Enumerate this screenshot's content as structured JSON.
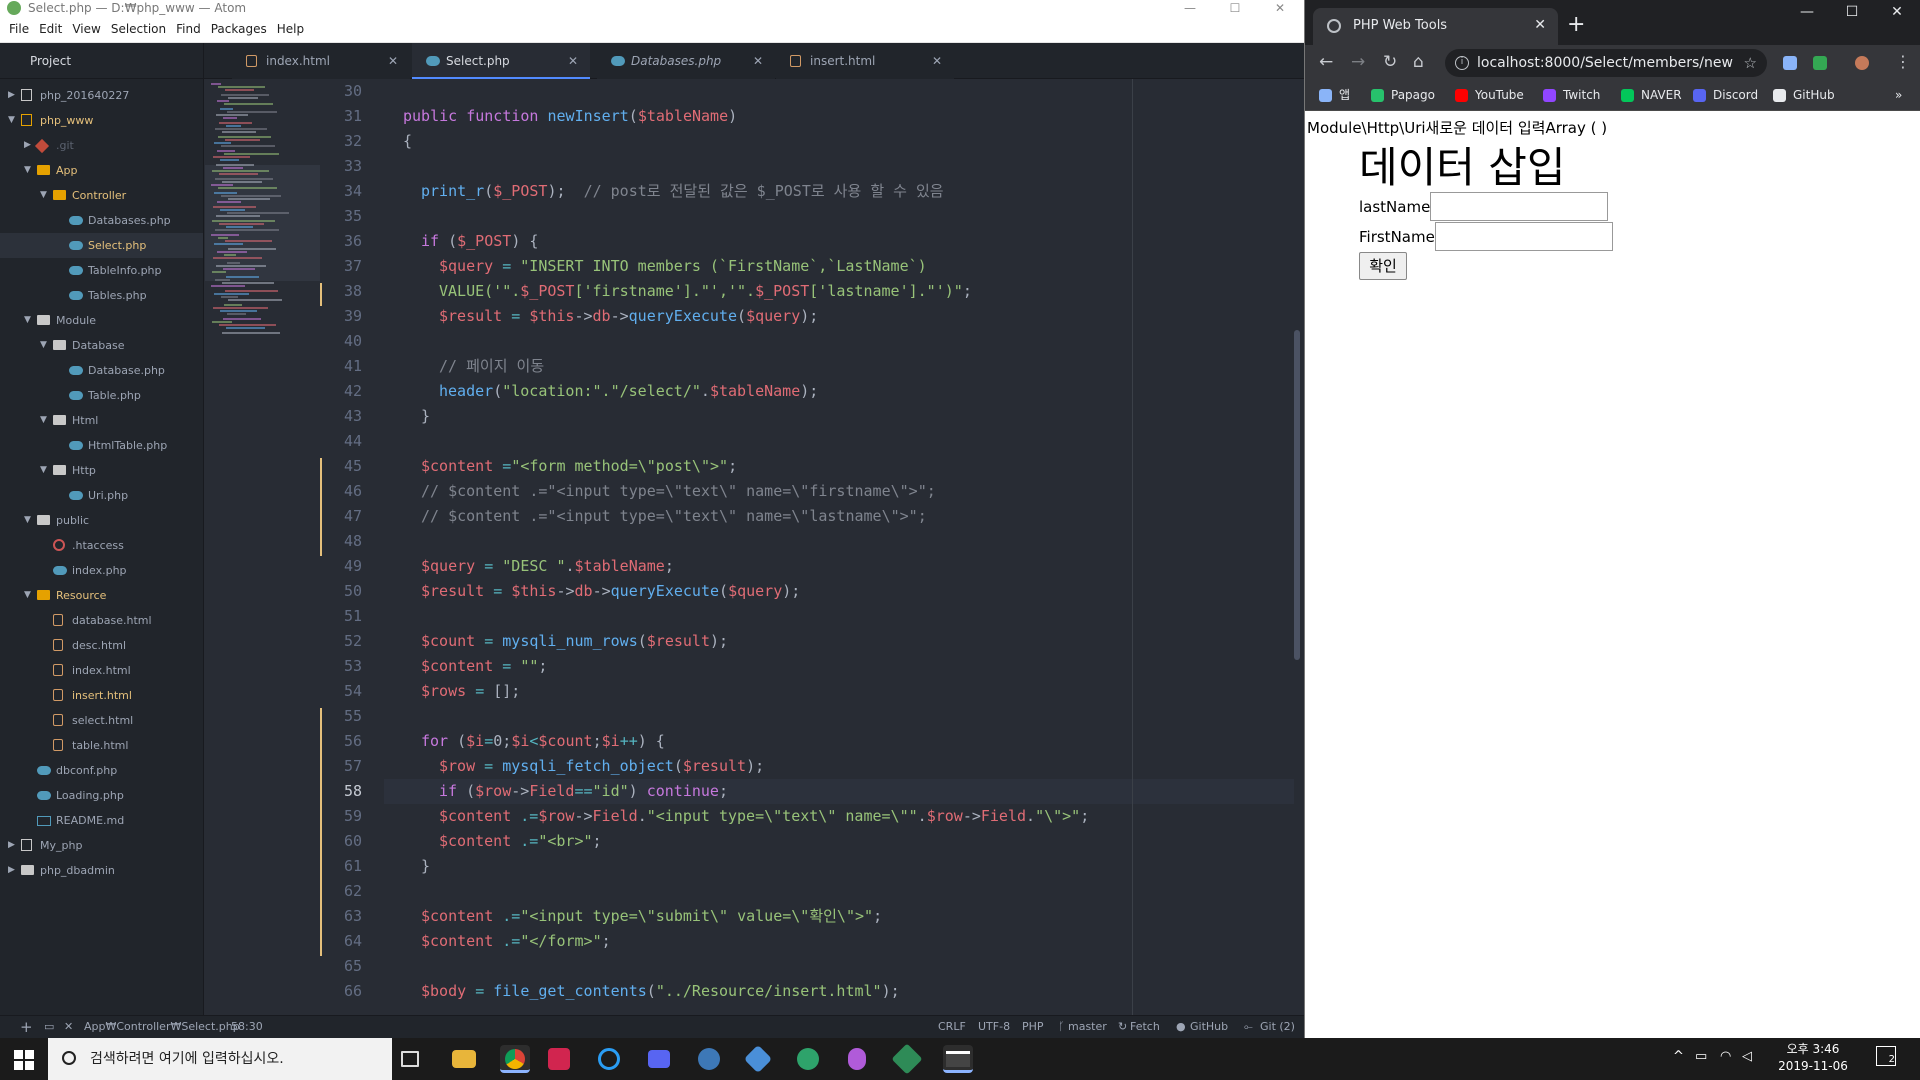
{
  "atom": {
    "title": "Select.php — D:₩php_www — Atom",
    "menu": [
      "File",
      "Edit",
      "View",
      "Selection",
      "Find",
      "Packages",
      "Help"
    ],
    "tree_header": "Project",
    "tabs": [
      {
        "label": "index.html",
        "type": "html",
        "active": false,
        "italic": false
      },
      {
        "label": "Select.php",
        "type": "php",
        "active": true,
        "italic": false
      },
      {
        "label": "Databases.php",
        "type": "php",
        "active": false,
        "italic": true
      },
      {
        "label": "insert.html",
        "type": "html",
        "active": false,
        "italic": false
      }
    ],
    "tree": [
      {
        "label": "php_201640227",
        "depth": 0,
        "icon": "repo",
        "arrow": "right",
        "mod": false,
        "sel": false
      },
      {
        "label": "php_www",
        "depth": 0,
        "icon": "repo",
        "arrow": "down",
        "mod": true,
        "sel": false
      },
      {
        "label": ".git",
        "depth": 1,
        "icon": "git",
        "arrow": "right",
        "mod": false,
        "sel": false,
        "dim": true
      },
      {
        "label": "App",
        "depth": 1,
        "icon": "folder",
        "arrow": "down",
        "mod": true,
        "sel": false
      },
      {
        "label": "Controller",
        "depth": 2,
        "icon": "folder",
        "arrow": "down",
        "mod": true,
        "sel": false
      },
      {
        "label": "Databases.php",
        "depth": 3,
        "icon": "php",
        "arrow": "",
        "mod": false,
        "sel": false
      },
      {
        "label": "Select.php",
        "depth": 3,
        "icon": "php",
        "arrow": "",
        "mod": true,
        "sel": true
      },
      {
        "label": "TableInfo.php",
        "depth": 3,
        "icon": "php",
        "arrow": "",
        "mod": false,
        "sel": false
      },
      {
        "label": "Tables.php",
        "depth": 3,
        "icon": "php",
        "arrow": "",
        "mod": false,
        "sel": false
      },
      {
        "label": "Module",
        "depth": 1,
        "icon": "folder",
        "arrow": "down",
        "mod": false,
        "sel": false
      },
      {
        "label": "Database",
        "depth": 2,
        "icon": "folder",
        "arrow": "down",
        "mod": false,
        "sel": false
      },
      {
        "label": "Database.php",
        "depth": 3,
        "icon": "php",
        "arrow": "",
        "mod": false,
        "sel": false
      },
      {
        "label": "Table.php",
        "depth": 3,
        "icon": "php",
        "arrow": "",
        "mod": false,
        "sel": false
      },
      {
        "label": "Html",
        "depth": 2,
        "icon": "folder",
        "arrow": "down",
        "mod": false,
        "sel": false
      },
      {
        "label": "HtmlTable.php",
        "depth": 3,
        "icon": "php",
        "arrow": "",
        "mod": false,
        "sel": false
      },
      {
        "label": "Http",
        "depth": 2,
        "icon": "folder",
        "arrow": "down",
        "mod": false,
        "sel": false
      },
      {
        "label": "Uri.php",
        "depth": 3,
        "icon": "php",
        "arrow": "",
        "mod": false,
        "sel": false
      },
      {
        "label": "public",
        "depth": 1,
        "icon": "folder",
        "arrow": "down",
        "mod": false,
        "sel": false
      },
      {
        "label": ".htaccess",
        "depth": 2,
        "icon": "gear",
        "arrow": "",
        "mod": false,
        "sel": false
      },
      {
        "label": "index.php",
        "depth": 2,
        "icon": "php",
        "arrow": "",
        "mod": false,
        "sel": false
      },
      {
        "label": "Resource",
        "depth": 1,
        "icon": "folder",
        "arrow": "down",
        "mod": true,
        "sel": false
      },
      {
        "label": "database.html",
        "depth": 2,
        "icon": "html",
        "arrow": "",
        "mod": false,
        "sel": false
      },
      {
        "label": "desc.html",
        "depth": 2,
        "icon": "html",
        "arrow": "",
        "mod": false,
        "sel": false
      },
      {
        "label": "index.html",
        "depth": 2,
        "icon": "html",
        "arrow": "",
        "mod": false,
        "sel": false
      },
      {
        "label": "insert.html",
        "depth": 2,
        "icon": "html",
        "arrow": "",
        "mod": true,
        "sel": false
      },
      {
        "label": "select.html",
        "depth": 2,
        "icon": "html",
        "arrow": "",
        "mod": false,
        "sel": false
      },
      {
        "label": "table.html",
        "depth": 2,
        "icon": "html",
        "arrow": "",
        "mod": false,
        "sel": false
      },
      {
        "label": "dbconf.php",
        "depth": 1,
        "icon": "php",
        "arrow": "",
        "mod": false,
        "sel": false
      },
      {
        "label": "Loading.php",
        "depth": 1,
        "icon": "php",
        "arrow": "",
        "mod": false,
        "sel": false
      },
      {
        "label": "README.md",
        "depth": 1,
        "icon": "md",
        "arrow": "",
        "mod": false,
        "sel": false
      },
      {
        "label": "My_php",
        "depth": 0,
        "icon": "repo",
        "arrow": "right",
        "mod": false,
        "sel": false
      },
      {
        "label": "php_dbadmin",
        "depth": 0,
        "icon": "folder",
        "arrow": "right",
        "mod": false,
        "sel": false
      }
    ],
    "cursor_line": 58,
    "code": [
      {
        "n": 30,
        "i": 0,
        "t": []
      },
      {
        "n": 31,
        "i": 0,
        "t": [
          [
            "k",
            "public "
          ],
          [
            "k",
            "function "
          ],
          [
            "f",
            "newInsert"
          ],
          [
            "t",
            "("
          ],
          [
            "v",
            "$tableName"
          ],
          [
            "t",
            ")"
          ]
        ]
      },
      {
        "n": 32,
        "i": 0,
        "t": [
          [
            "t",
            "{"
          ]
        ]
      },
      {
        "n": 33,
        "i": 0,
        "t": []
      },
      {
        "n": 34,
        "i": 1,
        "t": [
          [
            "f",
            "print_r"
          ],
          [
            "t",
            "("
          ],
          [
            "v",
            "$_POST"
          ],
          [
            "t",
            ");  "
          ],
          [
            "c",
            "// post로 전달된 값은 $_POST로 사용 할 수 있음"
          ]
        ]
      },
      {
        "n": 35,
        "i": 0,
        "t": []
      },
      {
        "n": 36,
        "i": 1,
        "t": [
          [
            "k",
            "if "
          ],
          [
            "t",
            "("
          ],
          [
            "v",
            "$_POST"
          ],
          [
            "t",
            ") {"
          ]
        ]
      },
      {
        "n": 37,
        "i": 2,
        "t": [
          [
            "v",
            "$query "
          ],
          [
            "o",
            "= "
          ],
          [
            "s",
            "\"INSERT INTO members (`FirstName`,`LastName`)"
          ]
        ]
      },
      {
        "n": 38,
        "i": 2,
        "t": [
          [
            "s",
            "VALUE('\"."
          ],
          [
            "v",
            "$_POST"
          ],
          [
            "s",
            "['firstname']"
          ],
          [
            "s",
            ".\"','\"."
          ],
          [
            "v",
            "$_POST"
          ],
          [
            "s",
            "['lastname']"
          ],
          [
            "s",
            ".\"')\""
          ],
          [
            "t",
            ";"
          ]
        ]
      },
      {
        "n": 39,
        "i": 2,
        "t": [
          [
            "v",
            "$result "
          ],
          [
            "o",
            "= "
          ],
          [
            "v",
            "$this"
          ],
          [
            "t",
            "->"
          ],
          [
            "v",
            "db"
          ],
          [
            "t",
            "->"
          ],
          [
            "f",
            "queryExecute"
          ],
          [
            "t",
            "("
          ],
          [
            "v",
            "$query"
          ],
          [
            "t",
            ");"
          ]
        ]
      },
      {
        "n": 40,
        "i": 0,
        "t": []
      },
      {
        "n": 41,
        "i": 2,
        "t": [
          [
            "c",
            "// 페이지 이동"
          ]
        ]
      },
      {
        "n": 42,
        "i": 2,
        "t": [
          [
            "f",
            "header"
          ],
          [
            "t",
            "("
          ],
          [
            "s",
            "\"location:\".\"/select/\""
          ],
          [
            "t",
            "."
          ],
          [
            "v",
            "$tableName"
          ],
          [
            "t",
            ");"
          ]
        ]
      },
      {
        "n": 43,
        "i": 1,
        "t": [
          [
            "t",
            "}"
          ]
        ]
      },
      {
        "n": 44,
        "i": 0,
        "t": []
      },
      {
        "n": 45,
        "i": 1,
        "t": [
          [
            "v",
            "$content "
          ],
          [
            "o",
            "="
          ],
          [
            "s",
            "\"<form method=\\\"post\\\">\""
          ],
          [
            "t",
            ";"
          ]
        ]
      },
      {
        "n": 46,
        "i": 1,
        "t": [
          [
            "c",
            "// $content .=\"<input type=\\\"text\\\" name=\\\"firstname\\\">\";"
          ]
        ]
      },
      {
        "n": 47,
        "i": 1,
        "t": [
          [
            "c",
            "// $content .=\"<input type=\\\"text\\\" name=\\\"lastname\\\">\";"
          ]
        ]
      },
      {
        "n": 48,
        "i": 0,
        "t": []
      },
      {
        "n": 49,
        "i": 1,
        "t": [
          [
            "v",
            "$query "
          ],
          [
            "o",
            "= "
          ],
          [
            "s",
            "\"DESC \""
          ],
          [
            "t",
            "."
          ],
          [
            "v",
            "$tableName"
          ],
          [
            "t",
            ";"
          ]
        ]
      },
      {
        "n": 50,
        "i": 1,
        "t": [
          [
            "v",
            "$result "
          ],
          [
            "o",
            "= "
          ],
          [
            "v",
            "$this"
          ],
          [
            "t",
            "->"
          ],
          [
            "v",
            "db"
          ],
          [
            "t",
            "->"
          ],
          [
            "f",
            "queryExecute"
          ],
          [
            "t",
            "("
          ],
          [
            "v",
            "$query"
          ],
          [
            "t",
            ");"
          ]
        ]
      },
      {
        "n": 51,
        "i": 0,
        "t": []
      },
      {
        "n": 52,
        "i": 1,
        "t": [
          [
            "v",
            "$count "
          ],
          [
            "o",
            "= "
          ],
          [
            "f",
            "mysqli_num_rows"
          ],
          [
            "t",
            "("
          ],
          [
            "v",
            "$result"
          ],
          [
            "t",
            ");"
          ]
        ]
      },
      {
        "n": 53,
        "i": 1,
        "t": [
          [
            "v",
            "$content "
          ],
          [
            "o",
            "= "
          ],
          [
            "s",
            "\"\""
          ],
          [
            "t",
            ";"
          ]
        ]
      },
      {
        "n": 54,
        "i": 1,
        "t": [
          [
            "v",
            "$rows "
          ],
          [
            "o",
            "= "
          ],
          [
            "t",
            "[];"
          ]
        ]
      },
      {
        "n": 55,
        "i": 0,
        "t": []
      },
      {
        "n": 56,
        "i": 1,
        "t": [
          [
            "k",
            "for "
          ],
          [
            "t",
            "("
          ],
          [
            "v",
            "$i"
          ],
          [
            "o",
            "="
          ],
          [
            "t",
            "0;"
          ],
          [
            "v",
            "$i"
          ],
          [
            "o",
            "<"
          ],
          [
            "v",
            "$count"
          ],
          [
            "t",
            ";"
          ],
          [
            "v",
            "$i"
          ],
          [
            "o",
            "++"
          ],
          [
            "t",
            ") {"
          ]
        ]
      },
      {
        "n": 57,
        "i": 2,
        "t": [
          [
            "v",
            "$row "
          ],
          [
            "o",
            "= "
          ],
          [
            "f",
            "mysqli_fetch_object"
          ],
          [
            "t",
            "("
          ],
          [
            "v",
            "$result"
          ],
          [
            "t",
            ");"
          ]
        ]
      },
      {
        "n": 58,
        "i": 2,
        "t": [
          [
            "k",
            "if "
          ],
          [
            "t",
            "("
          ],
          [
            "v",
            "$row"
          ],
          [
            "t",
            "->"
          ],
          [
            "v",
            "Field"
          ],
          [
            "o",
            "=="
          ],
          [
            "s",
            "\"id\""
          ],
          [
            "t",
            ") "
          ],
          [
            "k",
            "continue"
          ],
          [
            "t",
            ";"
          ]
        ]
      },
      {
        "n": 59,
        "i": 2,
        "t": [
          [
            "v",
            "$content "
          ],
          [
            "o",
            ".="
          ],
          [
            "v",
            "$row"
          ],
          [
            "t",
            "->"
          ],
          [
            "v",
            "Field"
          ],
          [
            "t",
            "."
          ],
          [
            "s",
            "\"<input type=\\\"text\\\" name=\\\"\""
          ],
          [
            "t",
            "."
          ],
          [
            "v",
            "$row"
          ],
          [
            "t",
            "->"
          ],
          [
            "v",
            "Field"
          ],
          [
            "t",
            "."
          ],
          [
            "s",
            "\"\\\">\""
          ],
          [
            "t",
            ";"
          ]
        ]
      },
      {
        "n": 60,
        "i": 2,
        "t": [
          [
            "v",
            "$content "
          ],
          [
            "o",
            ".="
          ],
          [
            "s",
            "\"<br>\""
          ],
          [
            "t",
            ";"
          ]
        ]
      },
      {
        "n": 61,
        "i": 1,
        "t": [
          [
            "t",
            "}"
          ]
        ]
      },
      {
        "n": 62,
        "i": 0,
        "t": []
      },
      {
        "n": 63,
        "i": 1,
        "t": [
          [
            "v",
            "$content "
          ],
          [
            "o",
            ".="
          ],
          [
            "s",
            "\"<input type=\\\"submit\\\" value=\\\"확인\\\">\""
          ],
          [
            "t",
            ";"
          ]
        ]
      },
      {
        "n": 64,
        "i": 1,
        "t": [
          [
            "v",
            "$content "
          ],
          [
            "o",
            ".="
          ],
          [
            "s",
            "\"</form>\""
          ],
          [
            "t",
            ";"
          ]
        ]
      },
      {
        "n": 65,
        "i": 0,
        "t": []
      },
      {
        "n": 66,
        "i": 1,
        "t": [
          [
            "v",
            "$body "
          ],
          [
            "o",
            "= "
          ],
          [
            "f",
            "file_get_contents"
          ],
          [
            "t",
            "("
          ],
          [
            "s",
            "\"../Resource/insert.html\""
          ],
          [
            "t",
            ");"
          ]
        ]
      }
    ],
    "status": {
      "path": "App₩Controller₩Select.php",
      "pos": "58:30",
      "line_ending": "CRLF",
      "encoding": "UTF-8",
      "grammar": "PHP",
      "branch": "master",
      "fetch": "Fetch",
      "github": "GitHub",
      "git": "Git (2)"
    }
  },
  "chrome": {
    "tab_title": "PHP Web Tools",
    "url": "localhost:8000/Select/members/new",
    "bookmarks": [
      {
        "label": "앱",
        "color": "#8ab4f8"
      },
      {
        "label": "Papago",
        "color": "#27c26c"
      },
      {
        "label": "YouTube",
        "color": "#ff0000"
      },
      {
        "label": "Twitch",
        "color": "#9146ff"
      },
      {
        "label": "NAVER",
        "color": "#03c75a"
      },
      {
        "label": "Discord",
        "color": "#5865f2"
      },
      {
        "label": "GitHub",
        "color": "#e8eaed"
      }
    ],
    "more_label": "»",
    "page": {
      "uri_line": "Module\\Http\\Uri새로운 데이터 입력Array ( )",
      "heading": "데이터 삽입",
      "field1_label": "lastName",
      "field2_label": "FirstName",
      "submit_label": "확인"
    }
  },
  "taskbar": {
    "search_placeholder": "검색하려면 여기에 입력하십시오.",
    "time": "오후 3:46",
    "date": "2019-11-06",
    "notif_count": "2"
  }
}
